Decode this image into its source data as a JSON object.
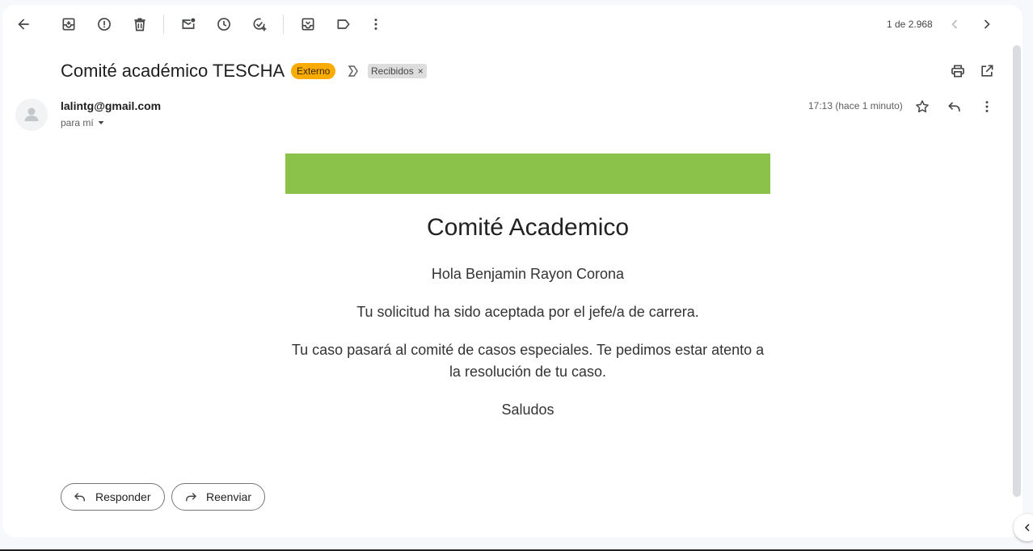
{
  "toolbar": {
    "back": "arrow-back-icon",
    "archive": "archive-icon",
    "report_spam": "report-spam-icon",
    "delete": "delete-icon",
    "mark_unread": "mark-unread-icon",
    "snooze": "snooze-icon",
    "add_task": "add-task-icon",
    "move_to": "move-to-icon",
    "labels": "label-icon",
    "more": "more-vert-icon",
    "pagination": "1 de 2.968"
  },
  "email": {
    "subject": "Comité académico TESCHA",
    "external_chip": "Externo",
    "label_chip": "Recibidos",
    "label_chip_close": "×",
    "sender": "lalintg@gmail.com",
    "recipient": "para mí",
    "time": "17:13 (hace 1 minuto)"
  },
  "message": {
    "heading": "Comité Academico",
    "greeting": "Hola Benjamin Rayon Corona",
    "line1": "Tu solicitud ha sido aceptada por el jefe/a de carrera.",
    "line2": "Tu caso pasará al comité de casos especiales. Te pedimos estar atento a la resolución de tu caso.",
    "closing": "Saludos"
  },
  "actions": {
    "reply": "Responder",
    "forward": "Reenviar"
  },
  "colors": {
    "banner": "#8bc34a",
    "external_chip": "#f9ab00",
    "label_chip": "#dddddd"
  }
}
